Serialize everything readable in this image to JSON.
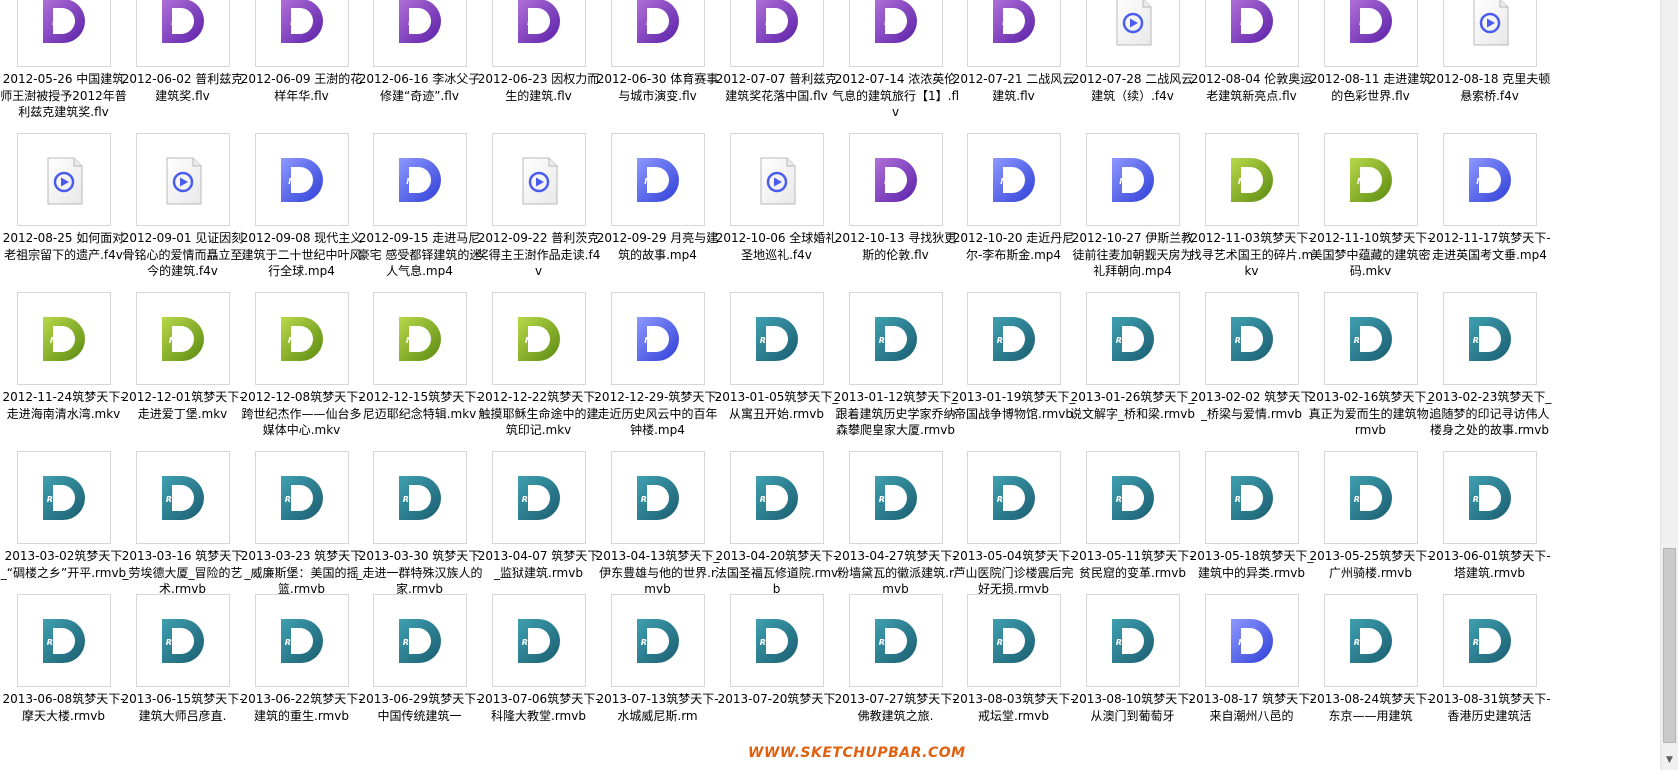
{
  "rows": [
    [
      {
        "name": "2012-05-26 中国建筑师王澍被授予2012年普利兹克建筑奖.flv",
        "type": "FLV"
      },
      {
        "name": "2012-06-02 普利兹克建筑奖.flv",
        "type": "FLV"
      },
      {
        "name": "2012-06-09 王澍的花样年华.flv",
        "type": "FLV"
      },
      {
        "name": "2012-06-16 李冰父子修建“奇迹”.flv",
        "type": "FLV"
      },
      {
        "name": "2012-06-23 因权力而生的建筑.flv",
        "type": "FLV"
      },
      {
        "name": "2012-06-30 体育赛事与城市演变.flv",
        "type": "FLV"
      },
      {
        "name": "2012-07-07 普利兹克建筑奖花落中国.flv",
        "type": "FLV"
      },
      {
        "name": "2012-07-14 浓浓英伦气息的建筑旅行【1】.flv",
        "type": "FLV"
      },
      {
        "name": "2012-07-21 二战风云建筑.flv",
        "type": "FLV"
      },
      {
        "name": "2012-07-28 二战风云建筑（续）.f4v",
        "type": "F4V"
      },
      {
        "name": "2012-08-04 伦敦奥运老建筑新亮点.flv",
        "type": "FLV"
      },
      {
        "name": "2012-08-11 走进建筑的色彩世界.flv",
        "type": "FLV"
      },
      {
        "name": "2012-08-18 克里夫顿悬索桥.f4v",
        "type": "F4V"
      }
    ],
    [
      {
        "name": "2012-08-25 如何面对老祖宗留下的遗产.f4v",
        "type": "F4V"
      },
      {
        "name": "2012-09-01 见证因刻骨铭心的爱情而矗立至今的建筑.f4v",
        "type": "F4V"
      },
      {
        "name": "2012-09-08 现代主义建筑于二十世纪中叶风行全球.mp4",
        "type": "MP4"
      },
      {
        "name": "2012-09-15 走进马尼豪宅 感受都铎建筑的迷人气息.mp4",
        "type": "MP4"
      },
      {
        "name": "2012-09-22 普利茨克奖得主王澍作品走读.f4v",
        "type": "F4V"
      },
      {
        "name": "2012-09-29 月亮与建筑的故事.mp4",
        "type": "MP4"
      },
      {
        "name": "2012-10-06 全球婚礼圣地巡礼.f4v",
        "type": "F4V"
      },
      {
        "name": "2012-10-13 寻找狄更斯的伦敦.flv",
        "type": "FLV"
      },
      {
        "name": "2012-10-20 走近丹尼尔-李布斯金.mp4",
        "type": "MP4"
      },
      {
        "name": "2012-10-27 伊斯兰教徒前往麦加朝觐天房为礼拜朝向.mp4",
        "type": "MP4"
      },
      {
        "name": "2012-11-03筑梦天下-找寻艺术国王的碎片.mkv",
        "type": "MKV"
      },
      {
        "name": "2012-11-10筑梦天下-美国梦中蕴藏的建筑密码.mkv",
        "type": "MKV"
      },
      {
        "name": "2012-11-17筑梦天下-走进英国考文垂.mp4",
        "type": "MP4"
      }
    ],
    [
      {
        "name": "2012-11-24筑梦天下-走进海南清水湾.mkv",
        "type": "MKV"
      },
      {
        "name": "2012-12-01筑梦天下-走进爱丁堡.mkv",
        "type": "MKV"
      },
      {
        "name": "2012-12-08筑梦天下-跨世纪杰作——仙台多媒体中心.mkv",
        "type": "MKV"
      },
      {
        "name": "2012-12-15筑梦天下-尼迈耶纪念特辑.mkv",
        "type": "MKV"
      },
      {
        "name": "2012-12-22筑梦天下-触摸耶稣生命途中的建筑印记.mkv",
        "type": "MKV"
      },
      {
        "name": "2012-12-29-筑梦天下-走近历史风云中的百年钟楼.mp4",
        "type": "MP4"
      },
      {
        "name": "2013-01-05筑梦天下_从寓丑开始.rmvb",
        "type": "RMVB"
      },
      {
        "name": "2013-01-12筑梦天下_跟着建筑历史学家乔纳森攀爬皇家大厦.rmvb",
        "type": "RMVB"
      },
      {
        "name": "2013-01-19筑梦天下_帝国战争博物馆.rmvb",
        "type": "RMVB"
      },
      {
        "name": "2013-01-26筑梦天下_说文解字_桥和梁.rmvb",
        "type": "RMVB"
      },
      {
        "name": "2013-02-02 筑梦天下_桥梁与爱情.rmvb",
        "type": "RMVB"
      },
      {
        "name": "2013-02-16筑梦天下_真正为爱而生的建筑物.rmvb",
        "type": "RMVB"
      },
      {
        "name": "2013-02-23筑梦天下_追随梦的印记寻访伟人楼身之处的故事.rmvb",
        "type": "RMVB"
      }
    ],
    [
      {
        "name": "2013-03-02筑梦天下_“碉楼之乡”开平.rmvb",
        "type": "RMVB"
      },
      {
        "name": "2013-03-16 筑梦天下_劳埃德大厦_冒险的艺术.rmvb",
        "type": "RMVB"
      },
      {
        "name": "2013-03-23 筑梦天下_威廉斯堡：美国的摇篮.rmvb",
        "type": "RMVB"
      },
      {
        "name": "2013-03-30 筑梦天下_走进一群特殊汉族人的家.rmvb",
        "type": "RMVB"
      },
      {
        "name": "2013-04-07 筑梦天下_监狱建筑.rmvb",
        "type": "RMVB"
      },
      {
        "name": "2013-04-13筑梦天下_伊东豊雄与他的世界.rmvb",
        "type": "RMVB"
      },
      {
        "name": "2013-04-20筑梦天下-法国圣福瓦修道院.rmvb",
        "type": "RMVB"
      },
      {
        "name": "2013-04-27筑梦天下-粉墙黛瓦的徽派建筑.rmvb",
        "type": "RMVB"
      },
      {
        "name": "2013-05-04筑梦天下-芦山医院门诊楼震后完好无损.rmvb",
        "type": "RMVB"
      },
      {
        "name": "2013-05-11筑梦天下-贫民窟的变革.rmvb",
        "type": "RMVB"
      },
      {
        "name": "2013-05-18筑梦天下_建筑中的异类.rmvb",
        "type": "RMVB"
      },
      {
        "name": "2013-05-25筑梦天下-广州骑楼.rmvb",
        "type": "RMVB"
      },
      {
        "name": "2013-06-01筑梦天下-塔建筑.rmvb",
        "type": "RMVB"
      }
    ],
    [
      {
        "name": "2013-06-08筑梦天下-摩天大楼.rmvb",
        "type": "RMVB"
      },
      {
        "name": "2013-06-15筑梦天下-建筑大师吕彦直.",
        "type": "RMVB"
      },
      {
        "name": "2013-06-22筑梦天下-建筑的重生.rmvb",
        "type": "RMVB"
      },
      {
        "name": "2013-06-29筑梦天下-中国传统建筑一",
        "type": "RMVB"
      },
      {
        "name": "2013-07-06筑梦天下-科隆大教堂.rmvb",
        "type": "RMVB"
      },
      {
        "name": "2013-07-13筑梦天下-水城威尼斯.rm",
        "type": "RMVB"
      },
      {
        "name": "2013-07-20筑梦天下",
        "type": "RMVB"
      },
      {
        "name": "2013-07-27筑梦天下-佛教建筑之旅.",
        "type": "RMVB"
      },
      {
        "name": "2013-08-03筑梦天下-戒坛堂.rmvb",
        "type": "RMVB"
      },
      {
        "name": "2013-08-10筑梦天下-从澳门到葡萄牙",
        "type": "RMVB"
      },
      {
        "name": "2013-08-17 筑梦天下-来自潮州八邑的",
        "type": "MP4"
      },
      {
        "name": "2013-08-24筑梦天下-东京——用建筑",
        "type": "RMVB"
      },
      {
        "name": "2013-08-31筑梦天下-香港历史建筑活",
        "type": "RMVB"
      }
    ]
  ],
  "watermark": "WWW.SKETCHUPBAR.COM",
  "scrollbar": {
    "down_arrow": "▼",
    "scroll_position": 0.8
  },
  "colors": {
    "FLV": [
      "#b070d8",
      "#5a1fa8"
    ],
    "MP4": [
      "#8d98ff",
      "#2f3fd6"
    ],
    "MKV": [
      "#b8d84a",
      "#5a8a10"
    ],
    "RMVB": [
      "#3fa0b0",
      "#1a5d70"
    ],
    "F4V": [
      "#4a5cf0",
      "#2030c0"
    ]
  }
}
